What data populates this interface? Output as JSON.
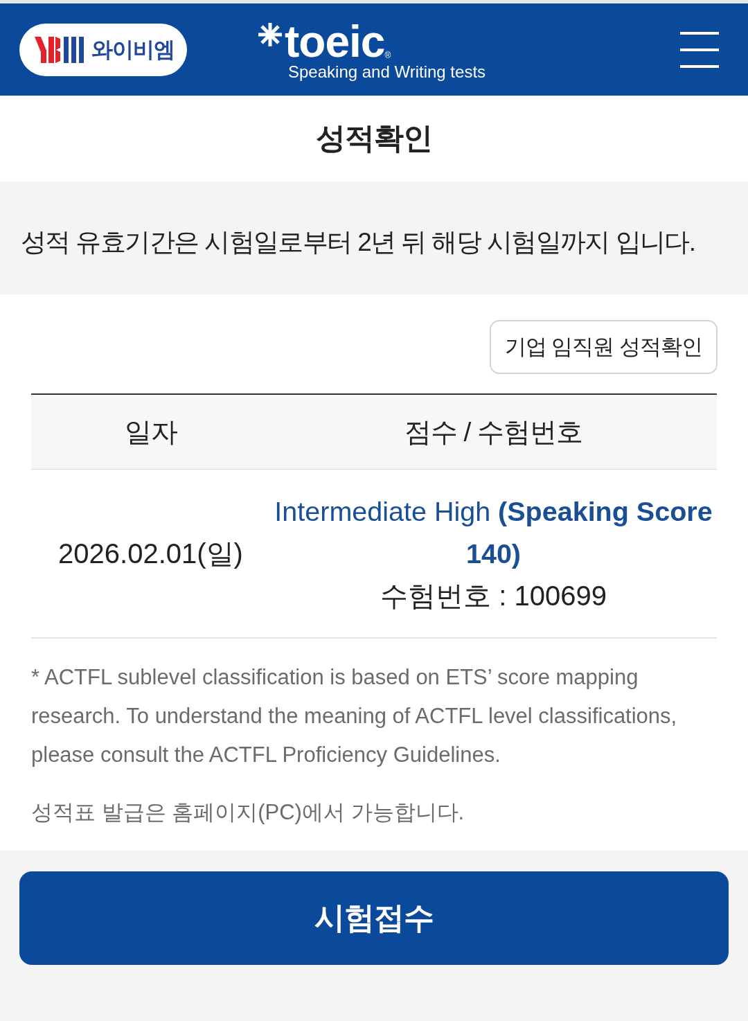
{
  "header": {
    "logo_text": "와이비엠",
    "wordmark": "toeic",
    "registered_mark": "®",
    "tagline": "Speaking and Writing tests"
  },
  "title": "성적확인",
  "notice": "성적 유효기간은 시험일로부터 2년 뒤 해당 시험일까지 입니다.",
  "corporate_button": "기업 임직원 성적확인",
  "table": {
    "columns": [
      "일자",
      "점수 / 수험번호"
    ],
    "rows": [
      {
        "date": "2026.02.01(일)",
        "score": "Intermediate High **(Speaking Score 140)**",
        "exam_number": "수험번호 : 100699"
      }
    ]
  },
  "notes": [
    "* ACTFL sublevel classification is based on ETS’ score mapping research. To understand the meaning of ACTFL level classifications, please consult the ACTFL Proficiency Guidelines.",
    "성적표 발급은 홈페이지(PC)에서 가능합니다."
  ],
  "apply_button": "시험접수"
}
